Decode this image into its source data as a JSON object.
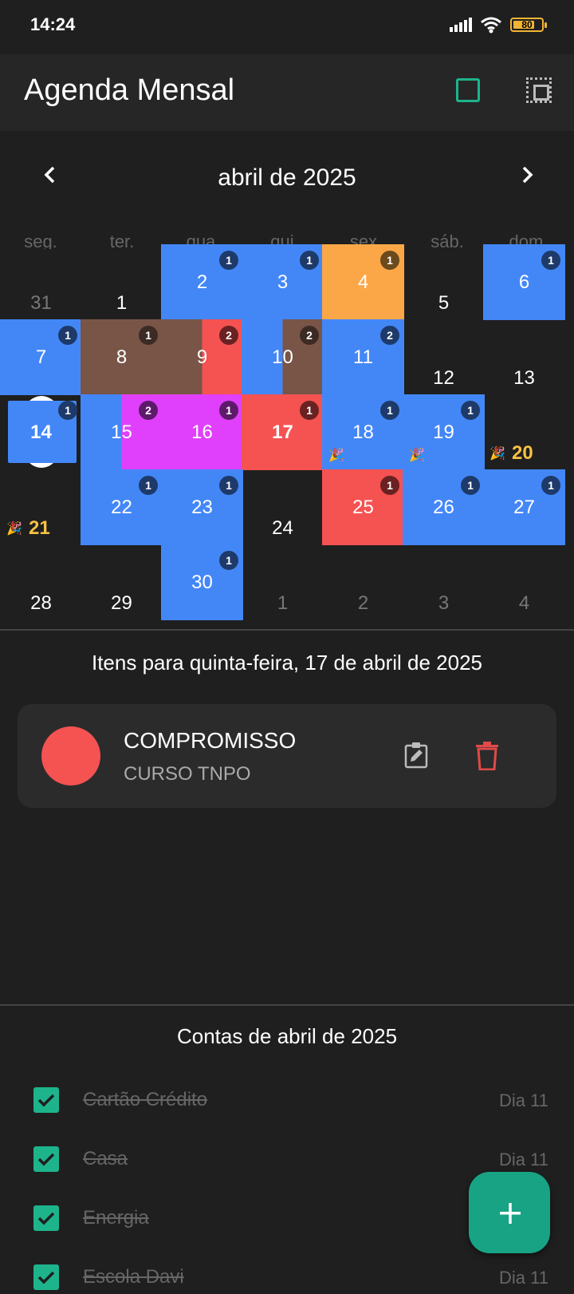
{
  "status": {
    "time": "14:24",
    "battery": "80"
  },
  "appbar": {
    "title": "Agenda Mensal"
  },
  "calendar": {
    "month_label": "abril de 2025",
    "weekdays": [
      "seg.",
      "ter.",
      "qua.",
      "qui.",
      "sex.",
      "sáb.",
      "dom."
    ],
    "rows": [
      [
        {
          "d": "31",
          "dim": true
        },
        {
          "d": "1"
        },
        {
          "d": "2",
          "c": "#4387f7",
          "b": "1",
          "bc": "#1e3a6a"
        },
        {
          "d": "3",
          "c": "#4387f7",
          "b": "1",
          "bc": "#1e3a6a"
        },
        {
          "d": "4",
          "c": "#fba748",
          "b": "1",
          "bc": "#6b4a1c"
        },
        {
          "d": "5"
        },
        {
          "d": "6",
          "c": "#4387f7",
          "b": "1",
          "bc": "#1e3a6a"
        }
      ],
      [
        {
          "d": "7",
          "c": "#4387f7",
          "b": "1",
          "bc": "#1e3a6a"
        },
        {
          "d": "8",
          "c": "#795548",
          "b": "1",
          "bc": "#3b2b24"
        },
        {
          "d": "9",
          "c": "#795548",
          "c2": "#f55252",
          "b": "2",
          "bc": "#6a2121"
        },
        {
          "d": "10",
          "c": "#4387f7",
          "c2": "#795548",
          "b": "2",
          "bc": "#3b2b24"
        },
        {
          "d": "11",
          "c": "#4387f7",
          "b": "2",
          "bc": "#1e3a6a"
        },
        {
          "d": "12"
        },
        {
          "d": "13"
        }
      ],
      [
        {
          "d": "14",
          "today": true,
          "b": "1",
          "bc": "#1e3a6a"
        },
        {
          "d": "15",
          "c": "#4387f7",
          "c2": "#e040fb"
        },
        {
          "d": "16",
          "c": "#e040fb",
          "b": "1",
          "bc": "#5d1a6a",
          "b2": "2",
          "bc2": "#5d1a6a"
        },
        {
          "d": "17",
          "c": "#f55252",
          "b": "1",
          "bc": "#6a2121",
          "sel": true
        },
        {
          "d": "18",
          "c": "#4387f7",
          "b": "1",
          "bc": "#1e3a6a",
          "party": true
        },
        {
          "d": "19",
          "c": "#4387f7",
          "b": "1",
          "bc": "#1e3a6a",
          "party": true
        },
        {
          "d": "20",
          "holiday": true
        }
      ],
      [
        {
          "d": "21",
          "holiday": true
        },
        {
          "d": "22",
          "c": "#4387f7",
          "b": "1",
          "bc": "#1e3a6a"
        },
        {
          "d": "23",
          "c": "#4387f7",
          "b": "1",
          "bc": "#1e3a6a"
        },
        {
          "d": "24"
        },
        {
          "d": "25",
          "c": "#f55252",
          "b": "1",
          "bc": "#6a2121"
        },
        {
          "d": "26",
          "c": "#4387f7",
          "b": "1",
          "bc": "#1e3a6a"
        },
        {
          "d": "27",
          "c": "#4387f7",
          "b": "1",
          "bc": "#1e3a6a"
        }
      ],
      [
        {
          "d": "28"
        },
        {
          "d": "29"
        },
        {
          "d": "30",
          "c": "#4387f7",
          "b": "1",
          "bc": "#1e3a6a"
        },
        {
          "d": "1",
          "dim": true
        },
        {
          "d": "2",
          "dim": true
        },
        {
          "d": "3",
          "dim": true
        },
        {
          "d": "4",
          "dim": true
        }
      ]
    ]
  },
  "items": {
    "title": "Itens para quinta-feira, 17 de abril de 2025",
    "entries": [
      {
        "type": "COMPROMISSO",
        "description": "CURSO TNPO",
        "color": "#f55252"
      }
    ]
  },
  "bills": {
    "title": "Contas de abril de 2025",
    "entries": [
      {
        "name": "Cartão Crédito",
        "day": "Dia 11",
        "paid": true
      },
      {
        "name": "Casa",
        "day": "Dia 11",
        "paid": true
      },
      {
        "name": "Energia",
        "day": "",
        "paid": true
      },
      {
        "name": "Escola Davi",
        "day": "Dia 11",
        "paid": true
      }
    ]
  },
  "fab": {
    "icon": "plus-icon"
  },
  "colors": {
    "accent": "#1db48c",
    "blue": "#4387f7",
    "red": "#f55252",
    "brown": "#795548",
    "orange": "#fba748",
    "purple": "#e040fb",
    "holiday": "#f7c244"
  }
}
